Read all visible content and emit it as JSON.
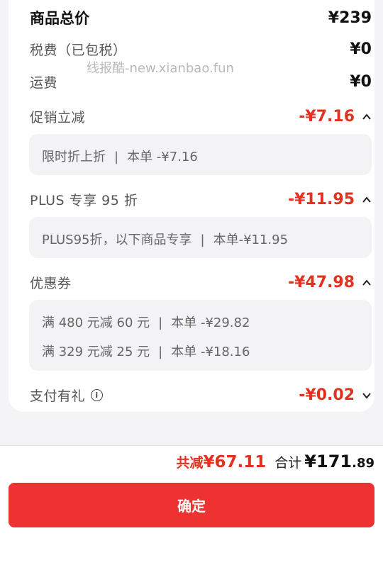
{
  "summary_card": {
    "goods_total": {
      "label": "商品总价",
      "value": "¥239"
    },
    "tax": {
      "label": "税费（已包税）",
      "value": "¥0"
    },
    "shipping": {
      "label": "运费",
      "value": "¥0"
    },
    "watermark": "线报酷-new.xianbao.fun",
    "promo": {
      "label": "促销立减",
      "value": "-¥7.16",
      "detail": {
        "name": "限时折上折",
        "amount": "本单 -¥7.16"
      }
    },
    "plus": {
      "label": "PLUS 专享 95 折",
      "value": "-¥11.95",
      "detail": {
        "name": "PLUS95折，以下商品专享",
        "amount": "本单-¥11.95"
      }
    },
    "coupon": {
      "label": "优惠券",
      "value": "-¥47.98",
      "details": [
        {
          "name": "满 480 元减 60 元",
          "amount": "本单 -¥29.82"
        },
        {
          "name": "满 329 元减 25 元",
          "amount": "本单 -¥18.16"
        }
      ]
    },
    "gift": {
      "label": "支付有礼",
      "value": "-¥0.02"
    }
  },
  "footer": {
    "discount_prefix": "共减",
    "discount_value": "¥67.11",
    "total_label": "合计",
    "total_currency": "¥",
    "total_int": "171",
    "total_dec": ".89",
    "confirm_label": "确定"
  },
  "colors": {
    "accent": "#e2321f",
    "button": "#ee3131"
  },
  "icons": [
    "chevron-up-icon",
    "chevron-down-icon",
    "info-icon"
  ]
}
